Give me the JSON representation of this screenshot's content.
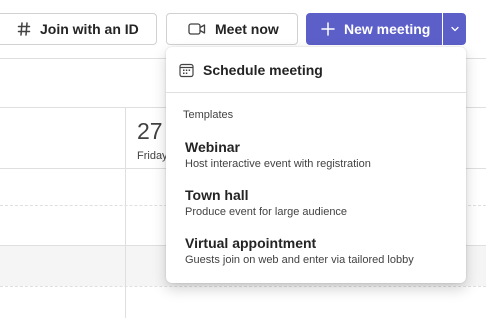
{
  "toolbar": {
    "join_label": "Join with an ID",
    "meet_now_label": "Meet now",
    "new_meeting_label": "New meeting",
    "accent_color": "#5b5fc7"
  },
  "calendar": {
    "day_number": "27",
    "day_name": "Friday"
  },
  "dropdown": {
    "schedule_label": "Schedule meeting",
    "templates_header": "Templates",
    "templates": [
      {
        "title": "Webinar",
        "description": "Host interactive event with registration"
      },
      {
        "title": "Town hall",
        "description": "Produce event for large audience"
      },
      {
        "title": "Virtual appointment",
        "description": "Guests join on web and enter via tailored lobby"
      }
    ]
  },
  "icons": {
    "join": "hashtag-icon",
    "meet_now": "video-camera-icon",
    "new_meeting": "plus-icon",
    "expand": "chevron-down-icon",
    "schedule": "calendar-icon"
  }
}
